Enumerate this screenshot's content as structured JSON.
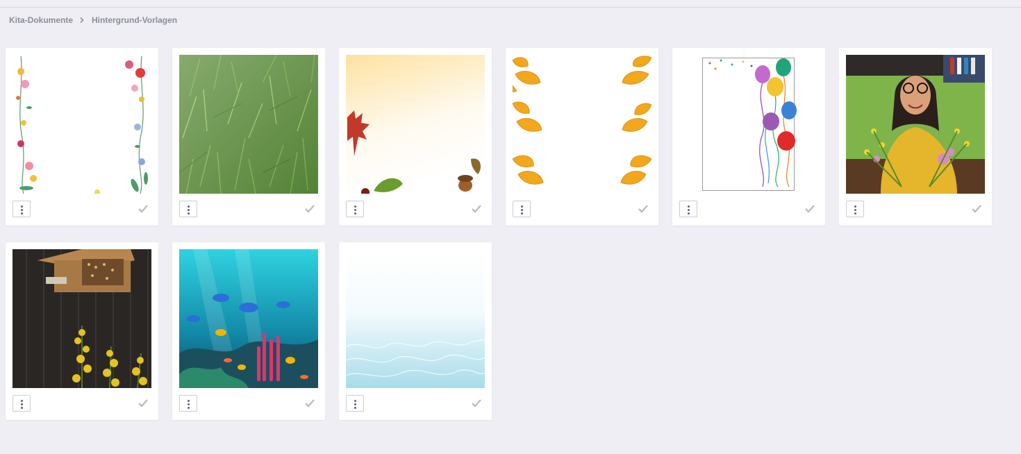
{
  "breadcrumb": {
    "root": "Kita-Dokumente",
    "current": "Hintergrund-Vorlagen",
    "separator_icon": "chevron-right-icon"
  },
  "colors": {
    "background": "#eeeef4",
    "card": "#ffffff",
    "check": "#b9bcc4",
    "menu_dot": "#5a607a"
  },
  "templates": [
    {
      "id": "flower-frame",
      "icon": "more-vertical-icon",
      "status_icon": "check-icon"
    },
    {
      "id": "grass",
      "icon": "more-vertical-icon",
      "status_icon": "check-icon"
    },
    {
      "id": "autumn-leaves-gradient",
      "icon": "more-vertical-icon",
      "status_icon": "check-icon"
    },
    {
      "id": "orange-leaves-border",
      "icon": "more-vertical-icon",
      "status_icon": "check-icon"
    },
    {
      "id": "balloons",
      "icon": "more-vertical-icon",
      "status_icon": "check-icon"
    },
    {
      "id": "woman-with-flowers",
      "icon": "more-vertical-icon",
      "status_icon": "check-icon"
    },
    {
      "id": "insect-hotel",
      "icon": "more-vertical-icon",
      "status_icon": "check-icon"
    },
    {
      "id": "underwater-reef",
      "icon": "more-vertical-icon",
      "status_icon": "check-icon"
    },
    {
      "id": "water-fade",
      "icon": "more-vertical-icon",
      "status_icon": "check-icon"
    }
  ]
}
